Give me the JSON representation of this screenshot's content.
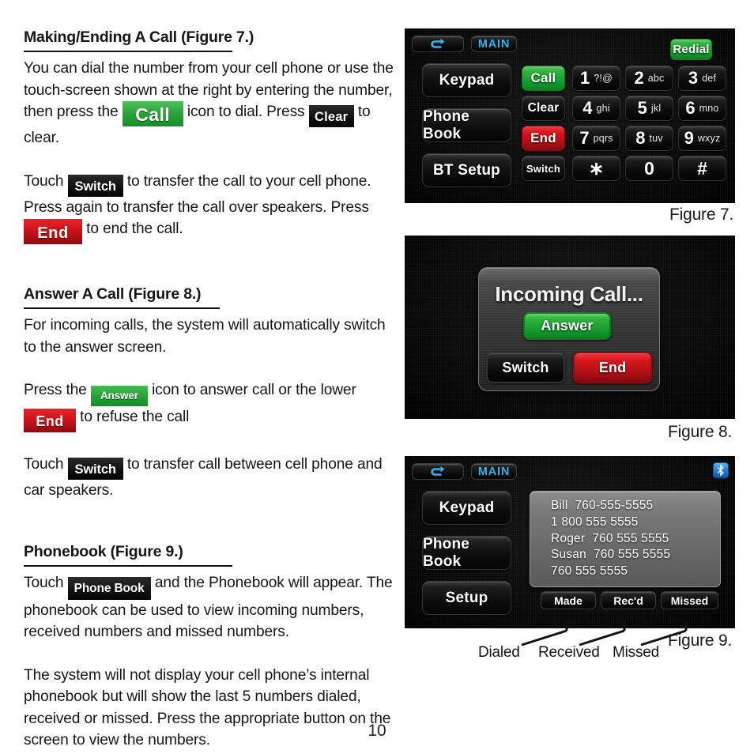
{
  "page": {
    "number": "10"
  },
  "sections": [
    {
      "id": "making-ending-a-call",
      "heading": "Making/Ending A Call (Figure 7.)",
      "p1_a": "You can dial the number from your cell phone or use the touch-screen shown at the right by entering the number, then press the ",
      "p1_badge1": "Call",
      "p1_b": " icon to dial. Press ",
      "p1_badge2": "Clear",
      "p1_c": " to clear.",
      "p2_a": "Touch ",
      "p2_badge1": "Switch",
      "p2_b": " to transfer the call to your cell phone.  Press again to transfer the call over speakers. Press ",
      "p2_badge2": "End",
      "p2_c": " to end the call."
    },
    {
      "id": "answer-a-call",
      "heading": "Answer A Call (Figure 8.)",
      "p1": "For incoming calls, the system will automatically switch to the answer screen.",
      "p2_a": "Press the ",
      "p2_badge1": "Answer",
      "p2_b": " icon to answer call or the lower ",
      "p2_badge2": "End",
      "p2_c": " to refuse the call",
      "p3_a": "Touch ",
      "p3_badge1": "Switch",
      "p3_b": " to transfer call between cell phone and car speakers."
    },
    {
      "id": "phonebook",
      "heading": "Phonebook (Figure 9.)",
      "p1_a": "Touch ",
      "p1_badge1": "Phone Book",
      "p1_b": " and the Phonebook will appear. The phonebook can be used to view incoming numbers, received numbers and missed numbers.",
      "p2": "The system will not display your cell phone’s internal phonebook but will show the last 5 numbers dialed, received or missed.  Press the appropriate button on the screen to view the numbers."
    }
  ],
  "figure7": {
    "caption": "Figure 7.",
    "back_icon": "back-arrow-icon",
    "main_label": "MAIN",
    "nav_buttons": [
      "Keypad",
      "Phone Book",
      "BT Setup"
    ],
    "redial_label": "Redial",
    "action_buttons": [
      "Call",
      "Clear",
      "End",
      "Switch"
    ],
    "keys": [
      {
        "num": "1",
        "letters": "?!@"
      },
      {
        "num": "2",
        "letters": "abc"
      },
      {
        "num": "3",
        "letters": "def"
      },
      {
        "num": "4",
        "letters": "ghi"
      },
      {
        "num": "5",
        "letters": "jkl"
      },
      {
        "num": "6",
        "letters": "mno"
      },
      {
        "num": "7",
        "letters": "pqrs"
      },
      {
        "num": "8",
        "letters": "tuv"
      },
      {
        "num": "9",
        "letters": "wxyz"
      },
      {
        "num": "∗",
        "letters": ""
      },
      {
        "num": "0",
        "letters": ""
      },
      {
        "num": "#",
        "letters": ""
      }
    ],
    "colors": {
      "call": "#1a9c2e",
      "end": "#cf1218",
      "redial": "#1fa936",
      "accent": "#2fb6f0"
    }
  },
  "figure8": {
    "caption": "Figure 8.",
    "title": "Incoming Call...",
    "answer_label": "Answer",
    "switch_label": "Switch",
    "end_label": "End",
    "colors": {
      "answer": "#19a12d",
      "end": "#e2191f"
    }
  },
  "figure9": {
    "caption": "Figure 9.",
    "back_icon": "back-arrow-icon",
    "main_label": "MAIN",
    "bluetooth_icon": "bluetooth-icon",
    "nav_buttons": [
      "Keypad",
      "Phone Book",
      "Setup"
    ],
    "list_rows": [
      "Bill  760-555-5555",
      "1 800 555 5555",
      "Roger  760 555 5555",
      "Susan  760 555 5555",
      "760 555 5555"
    ],
    "tabs": [
      "Made",
      "Rec'd",
      "Missed"
    ],
    "callouts": [
      "Dialed",
      "Received",
      "Missed"
    ]
  }
}
